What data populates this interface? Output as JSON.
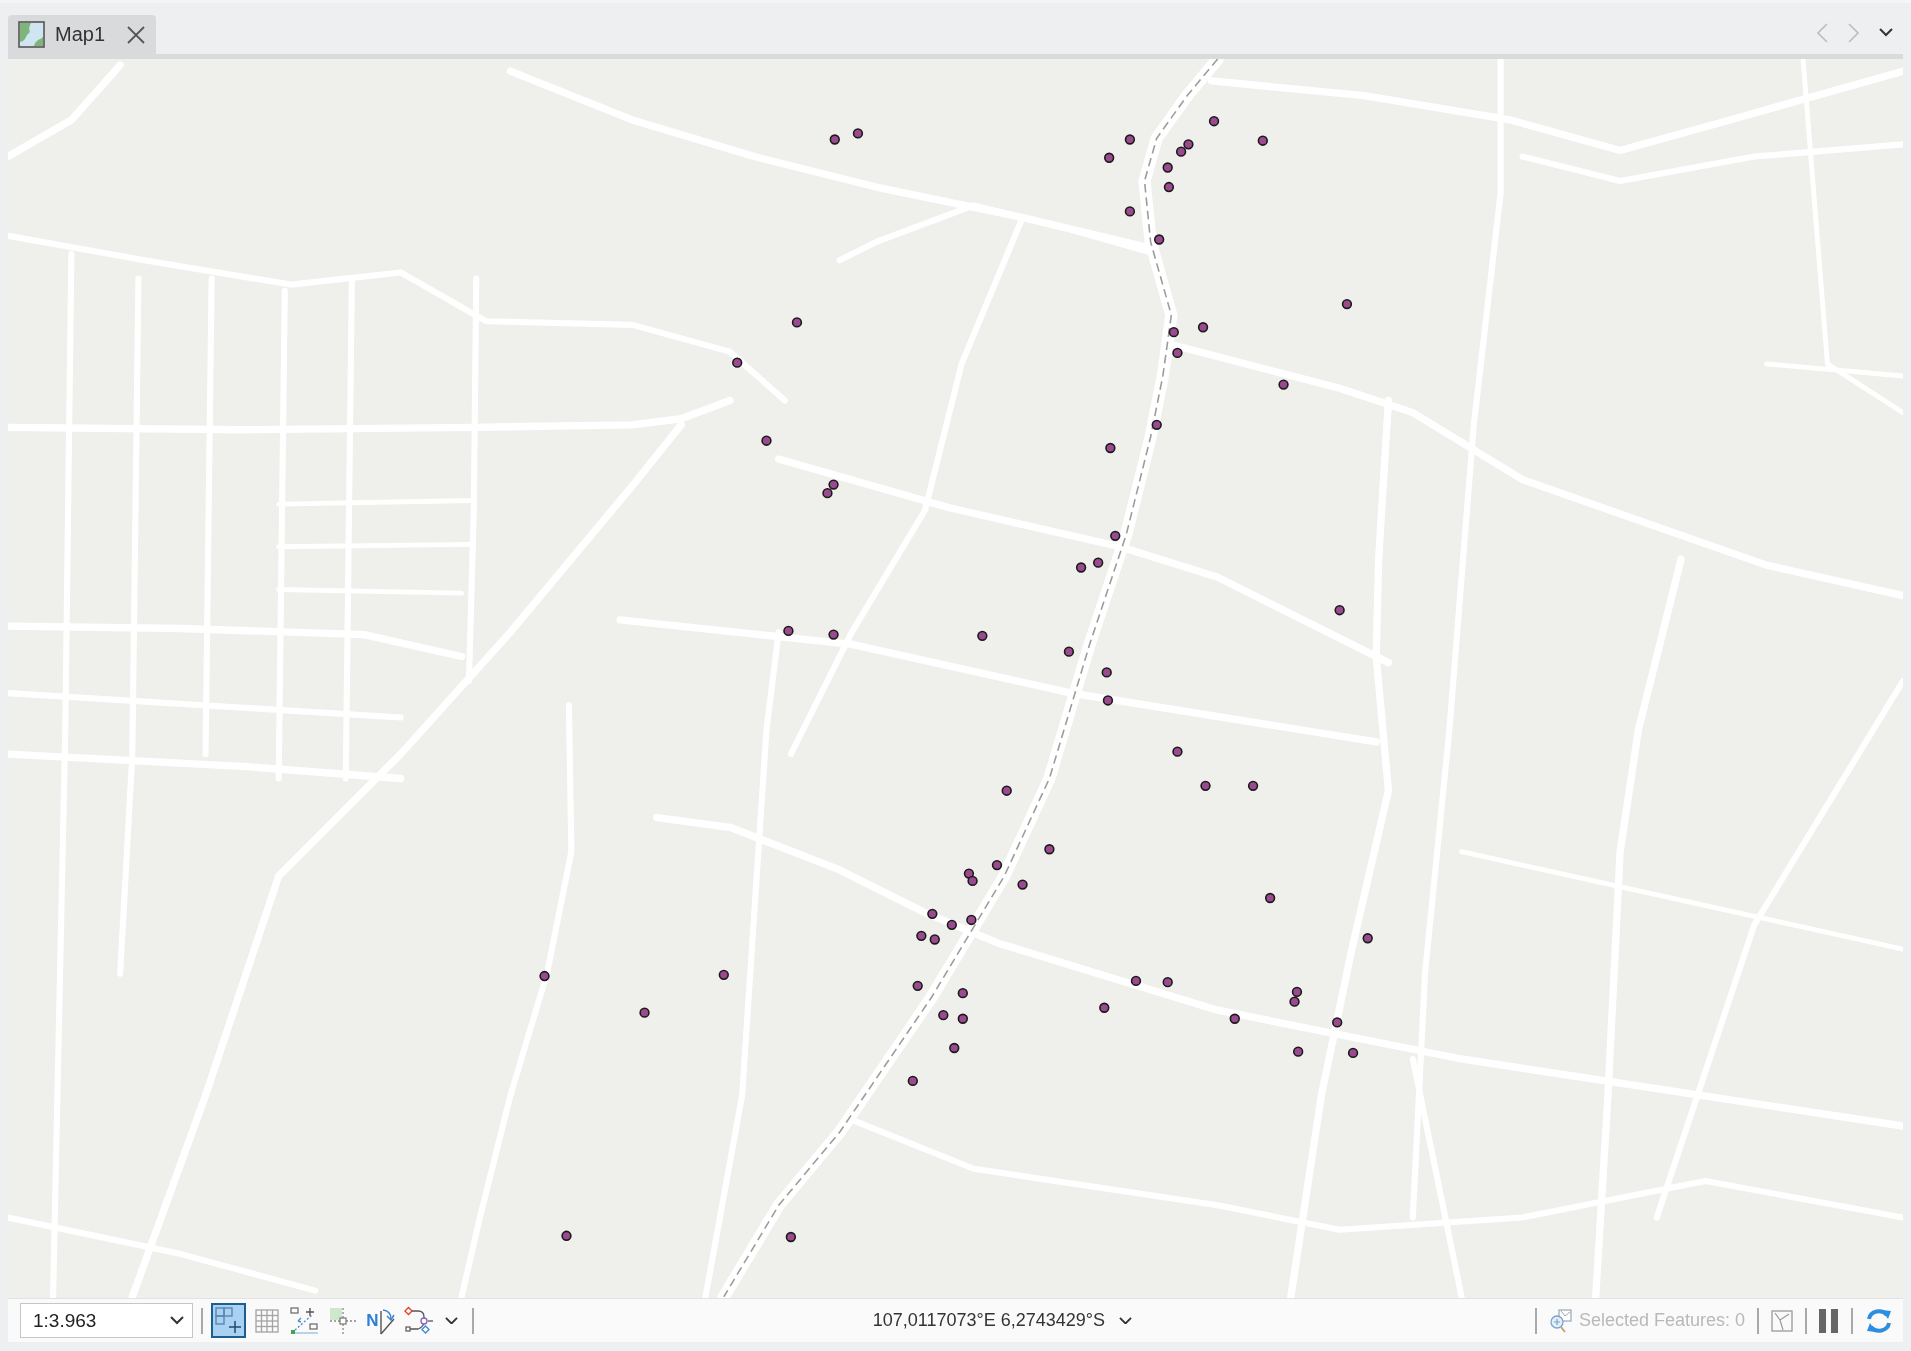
{
  "tabs": [
    {
      "label": "Map1",
      "selected": true
    }
  ],
  "tab_nav": {
    "back_disabled": true,
    "forward_disabled": true
  },
  "status_bar": {
    "scale": "1:3.963",
    "tools": [
      {
        "kind": "grid_plus",
        "selected": true
      },
      {
        "kind": "table_grid",
        "selected": false
      },
      {
        "kind": "resize_points",
        "selected": false
      },
      {
        "kind": "crosshair",
        "selected": false
      },
      {
        "kind": "north_arrow",
        "glyph": "N",
        "selected": false
      },
      {
        "kind": "node_path",
        "selected": false
      }
    ],
    "coordinates": "107,0117073°E 6,2743429°S",
    "selected_features": {
      "label": "Selected Features: 0",
      "disabled": true
    }
  }
}
